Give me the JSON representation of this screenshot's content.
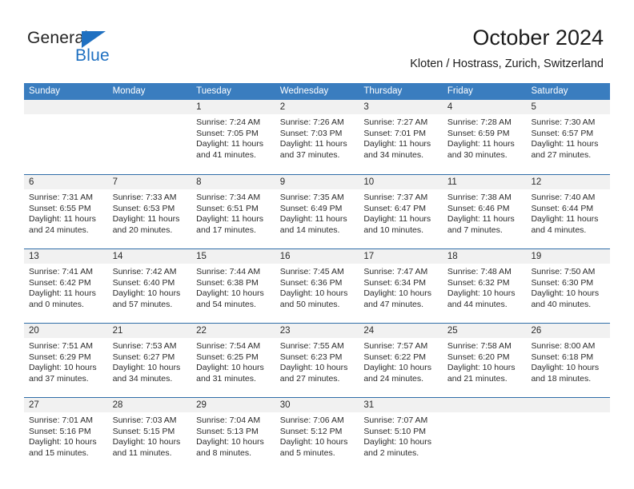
{
  "brand": {
    "name_top": "General",
    "name_bottom": "Blue",
    "triangle_color": "#1f70c1"
  },
  "header": {
    "title": "October 2024",
    "subtitle": "Kloten / Hostrass, Zurich, Switzerland"
  },
  "theme": {
    "header_row_bg": "#3a7dbf",
    "week_separator": "#2f6da8",
    "date_band_bg": "#f1f1f1",
    "text": "#2b2b2b"
  },
  "calendar": {
    "weekday_headers": [
      "Sunday",
      "Monday",
      "Tuesday",
      "Wednesday",
      "Thursday",
      "Friday",
      "Saturday"
    ],
    "weeks": [
      [
        {
          "date": "",
          "sunrise": "",
          "sunset": "",
          "daylight_line1": "",
          "daylight_line2": "",
          "empty": true
        },
        {
          "date": "",
          "sunrise": "",
          "sunset": "",
          "daylight_line1": "",
          "daylight_line2": "",
          "empty": true
        },
        {
          "date": "1",
          "sunrise": "Sunrise: 7:24 AM",
          "sunset": "Sunset: 7:05 PM",
          "daylight_line1": "Daylight: 11 hours",
          "daylight_line2": "and 41 minutes."
        },
        {
          "date": "2",
          "sunrise": "Sunrise: 7:26 AM",
          "sunset": "Sunset: 7:03 PM",
          "daylight_line1": "Daylight: 11 hours",
          "daylight_line2": "and 37 minutes."
        },
        {
          "date": "3",
          "sunrise": "Sunrise: 7:27 AM",
          "sunset": "Sunset: 7:01 PM",
          "daylight_line1": "Daylight: 11 hours",
          "daylight_line2": "and 34 minutes."
        },
        {
          "date": "4",
          "sunrise": "Sunrise: 7:28 AM",
          "sunset": "Sunset: 6:59 PM",
          "daylight_line1": "Daylight: 11 hours",
          "daylight_line2": "and 30 minutes."
        },
        {
          "date": "5",
          "sunrise": "Sunrise: 7:30 AM",
          "sunset": "Sunset: 6:57 PM",
          "daylight_line1": "Daylight: 11 hours",
          "daylight_line2": "and 27 minutes."
        }
      ],
      [
        {
          "date": "6",
          "sunrise": "Sunrise: 7:31 AM",
          "sunset": "Sunset: 6:55 PM",
          "daylight_line1": "Daylight: 11 hours",
          "daylight_line2": "and 24 minutes."
        },
        {
          "date": "7",
          "sunrise": "Sunrise: 7:33 AM",
          "sunset": "Sunset: 6:53 PM",
          "daylight_line1": "Daylight: 11 hours",
          "daylight_line2": "and 20 minutes."
        },
        {
          "date": "8",
          "sunrise": "Sunrise: 7:34 AM",
          "sunset": "Sunset: 6:51 PM",
          "daylight_line1": "Daylight: 11 hours",
          "daylight_line2": "and 17 minutes."
        },
        {
          "date": "9",
          "sunrise": "Sunrise: 7:35 AM",
          "sunset": "Sunset: 6:49 PM",
          "daylight_line1": "Daylight: 11 hours",
          "daylight_line2": "and 14 minutes."
        },
        {
          "date": "10",
          "sunrise": "Sunrise: 7:37 AM",
          "sunset": "Sunset: 6:47 PM",
          "daylight_line1": "Daylight: 11 hours",
          "daylight_line2": "and 10 minutes."
        },
        {
          "date": "11",
          "sunrise": "Sunrise: 7:38 AM",
          "sunset": "Sunset: 6:46 PM",
          "daylight_line1": "Daylight: 11 hours",
          "daylight_line2": "and 7 minutes."
        },
        {
          "date": "12",
          "sunrise": "Sunrise: 7:40 AM",
          "sunset": "Sunset: 6:44 PM",
          "daylight_line1": "Daylight: 11 hours",
          "daylight_line2": "and 4 minutes."
        }
      ],
      [
        {
          "date": "13",
          "sunrise": "Sunrise: 7:41 AM",
          "sunset": "Sunset: 6:42 PM",
          "daylight_line1": "Daylight: 11 hours",
          "daylight_line2": "and 0 minutes."
        },
        {
          "date": "14",
          "sunrise": "Sunrise: 7:42 AM",
          "sunset": "Sunset: 6:40 PM",
          "daylight_line1": "Daylight: 10 hours",
          "daylight_line2": "and 57 minutes."
        },
        {
          "date": "15",
          "sunrise": "Sunrise: 7:44 AM",
          "sunset": "Sunset: 6:38 PM",
          "daylight_line1": "Daylight: 10 hours",
          "daylight_line2": "and 54 minutes."
        },
        {
          "date": "16",
          "sunrise": "Sunrise: 7:45 AM",
          "sunset": "Sunset: 6:36 PM",
          "daylight_line1": "Daylight: 10 hours",
          "daylight_line2": "and 50 minutes."
        },
        {
          "date": "17",
          "sunrise": "Sunrise: 7:47 AM",
          "sunset": "Sunset: 6:34 PM",
          "daylight_line1": "Daylight: 10 hours",
          "daylight_line2": "and 47 minutes."
        },
        {
          "date": "18",
          "sunrise": "Sunrise: 7:48 AM",
          "sunset": "Sunset: 6:32 PM",
          "daylight_line1": "Daylight: 10 hours",
          "daylight_line2": "and 44 minutes."
        },
        {
          "date": "19",
          "sunrise": "Sunrise: 7:50 AM",
          "sunset": "Sunset: 6:30 PM",
          "daylight_line1": "Daylight: 10 hours",
          "daylight_line2": "and 40 minutes."
        }
      ],
      [
        {
          "date": "20",
          "sunrise": "Sunrise: 7:51 AM",
          "sunset": "Sunset: 6:29 PM",
          "daylight_line1": "Daylight: 10 hours",
          "daylight_line2": "and 37 minutes."
        },
        {
          "date": "21",
          "sunrise": "Sunrise: 7:53 AM",
          "sunset": "Sunset: 6:27 PM",
          "daylight_line1": "Daylight: 10 hours",
          "daylight_line2": "and 34 minutes."
        },
        {
          "date": "22",
          "sunrise": "Sunrise: 7:54 AM",
          "sunset": "Sunset: 6:25 PM",
          "daylight_line1": "Daylight: 10 hours",
          "daylight_line2": "and 31 minutes."
        },
        {
          "date": "23",
          "sunrise": "Sunrise: 7:55 AM",
          "sunset": "Sunset: 6:23 PM",
          "daylight_line1": "Daylight: 10 hours",
          "daylight_line2": "and 27 minutes."
        },
        {
          "date": "24",
          "sunrise": "Sunrise: 7:57 AM",
          "sunset": "Sunset: 6:22 PM",
          "daylight_line1": "Daylight: 10 hours",
          "daylight_line2": "and 24 minutes."
        },
        {
          "date": "25",
          "sunrise": "Sunrise: 7:58 AM",
          "sunset": "Sunset: 6:20 PM",
          "daylight_line1": "Daylight: 10 hours",
          "daylight_line2": "and 21 minutes."
        },
        {
          "date": "26",
          "sunrise": "Sunrise: 8:00 AM",
          "sunset": "Sunset: 6:18 PM",
          "daylight_line1": "Daylight: 10 hours",
          "daylight_line2": "and 18 minutes."
        }
      ],
      [
        {
          "date": "27",
          "sunrise": "Sunrise: 7:01 AM",
          "sunset": "Sunset: 5:16 PM",
          "daylight_line1": "Daylight: 10 hours",
          "daylight_line2": "and 15 minutes."
        },
        {
          "date": "28",
          "sunrise": "Sunrise: 7:03 AM",
          "sunset": "Sunset: 5:15 PM",
          "daylight_line1": "Daylight: 10 hours",
          "daylight_line2": "and 11 minutes."
        },
        {
          "date": "29",
          "sunrise": "Sunrise: 7:04 AM",
          "sunset": "Sunset: 5:13 PM",
          "daylight_line1": "Daylight: 10 hours",
          "daylight_line2": "and 8 minutes."
        },
        {
          "date": "30",
          "sunrise": "Sunrise: 7:06 AM",
          "sunset": "Sunset: 5:12 PM",
          "daylight_line1": "Daylight: 10 hours",
          "daylight_line2": "and 5 minutes."
        },
        {
          "date": "31",
          "sunrise": "Sunrise: 7:07 AM",
          "sunset": "Sunset: 5:10 PM",
          "daylight_line1": "Daylight: 10 hours",
          "daylight_line2": "and 2 minutes."
        },
        {
          "date": "",
          "sunrise": "",
          "sunset": "",
          "daylight_line1": "",
          "daylight_line2": "",
          "empty": true
        },
        {
          "date": "",
          "sunrise": "",
          "sunset": "",
          "daylight_line1": "",
          "daylight_line2": "",
          "empty": true
        }
      ]
    ]
  }
}
